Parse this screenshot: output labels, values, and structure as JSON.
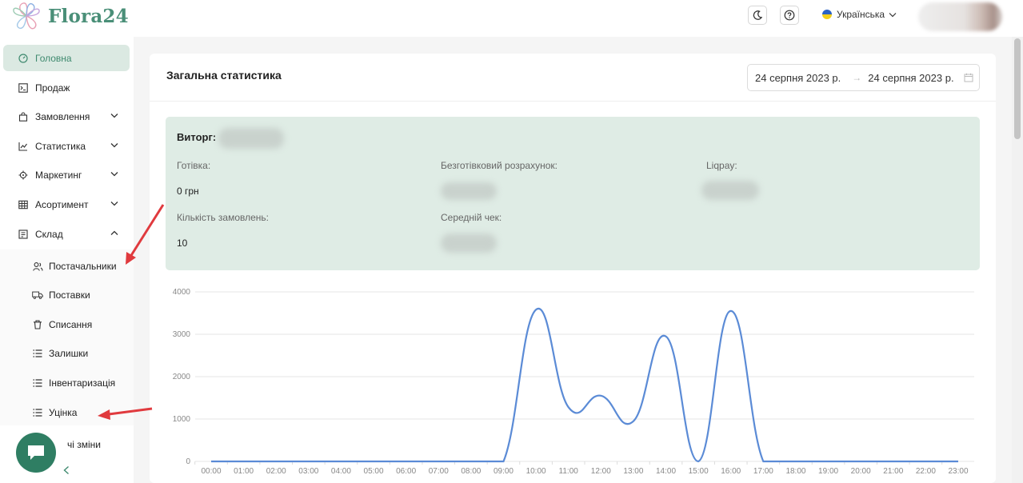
{
  "header": {
    "brand": "Flora24",
    "theme_icon": "moon-icon",
    "help_icon": "question-circle-icon",
    "language": "Українська"
  },
  "sidebar": {
    "items": [
      {
        "label": "Головна",
        "icon": "dashboard-icon",
        "active": true
      },
      {
        "label": "Продаж",
        "icon": "terminal-icon"
      },
      {
        "label": "Замовлення",
        "icon": "bag-icon",
        "expandable": true
      },
      {
        "label": "Статистика",
        "icon": "line-chart-icon",
        "expandable": true
      },
      {
        "label": "Маркетинг",
        "icon": "aim-icon",
        "expandable": true
      },
      {
        "label": "Асортимент",
        "icon": "table-icon",
        "expandable": true
      },
      {
        "label": "Склад",
        "icon": "warehouse-icon",
        "expanded": true
      }
    ],
    "warehouse_subitems": [
      {
        "label": "Постачальники",
        "icon": "users-icon"
      },
      {
        "label": "Поставки",
        "icon": "truck-icon"
      },
      {
        "label": "Списання",
        "icon": "trash-icon"
      },
      {
        "label": "Залишки",
        "icon": "list-icon"
      },
      {
        "label": "Інвентаризація",
        "icon": "list-icon"
      },
      {
        "label": "Уцінка",
        "icon": "list-icon"
      }
    ],
    "partial_item": "чі зміни"
  },
  "main": {
    "title": "Загальна статистика",
    "date_from": "24 серпня 2023 р.",
    "date_to": "24 серпня 2023 р.",
    "stats": {
      "revenue_label": "Виторг:",
      "cash_label": "Готівка:",
      "cash_value": "0 грн",
      "cashless_label": "Безготівковий розрахунок:",
      "liqpay_label": "Liqpay:",
      "orders_label": "Кількість замовлень:",
      "orders_value": "10",
      "avg_check_label": "Середній чек:"
    }
  },
  "chart_data": {
    "type": "line",
    "x": [
      "00:00",
      "01:00",
      "02:00",
      "03:00",
      "04:00",
      "05:00",
      "06:00",
      "07:00",
      "08:00",
      "09:00",
      "10:00",
      "11:00",
      "12:00",
      "13:00",
      "14:00",
      "15:00",
      "16:00",
      "17:00",
      "18:00",
      "19:00",
      "20:00",
      "21:00",
      "22:00",
      "23:00"
    ],
    "series": [
      {
        "values": [
          0,
          0,
          0,
          0,
          0,
          0,
          0,
          0,
          0,
          0,
          3580,
          1280,
          1550,
          950,
          2950,
          0,
          3550,
          0,
          0,
          0,
          0,
          0,
          0,
          0
        ]
      }
    ],
    "ylim": [
      0,
      4000
    ],
    "yticks": [
      0,
      1000,
      2000,
      3000,
      4000
    ],
    "grid": true,
    "color": "#5b8bd6"
  }
}
